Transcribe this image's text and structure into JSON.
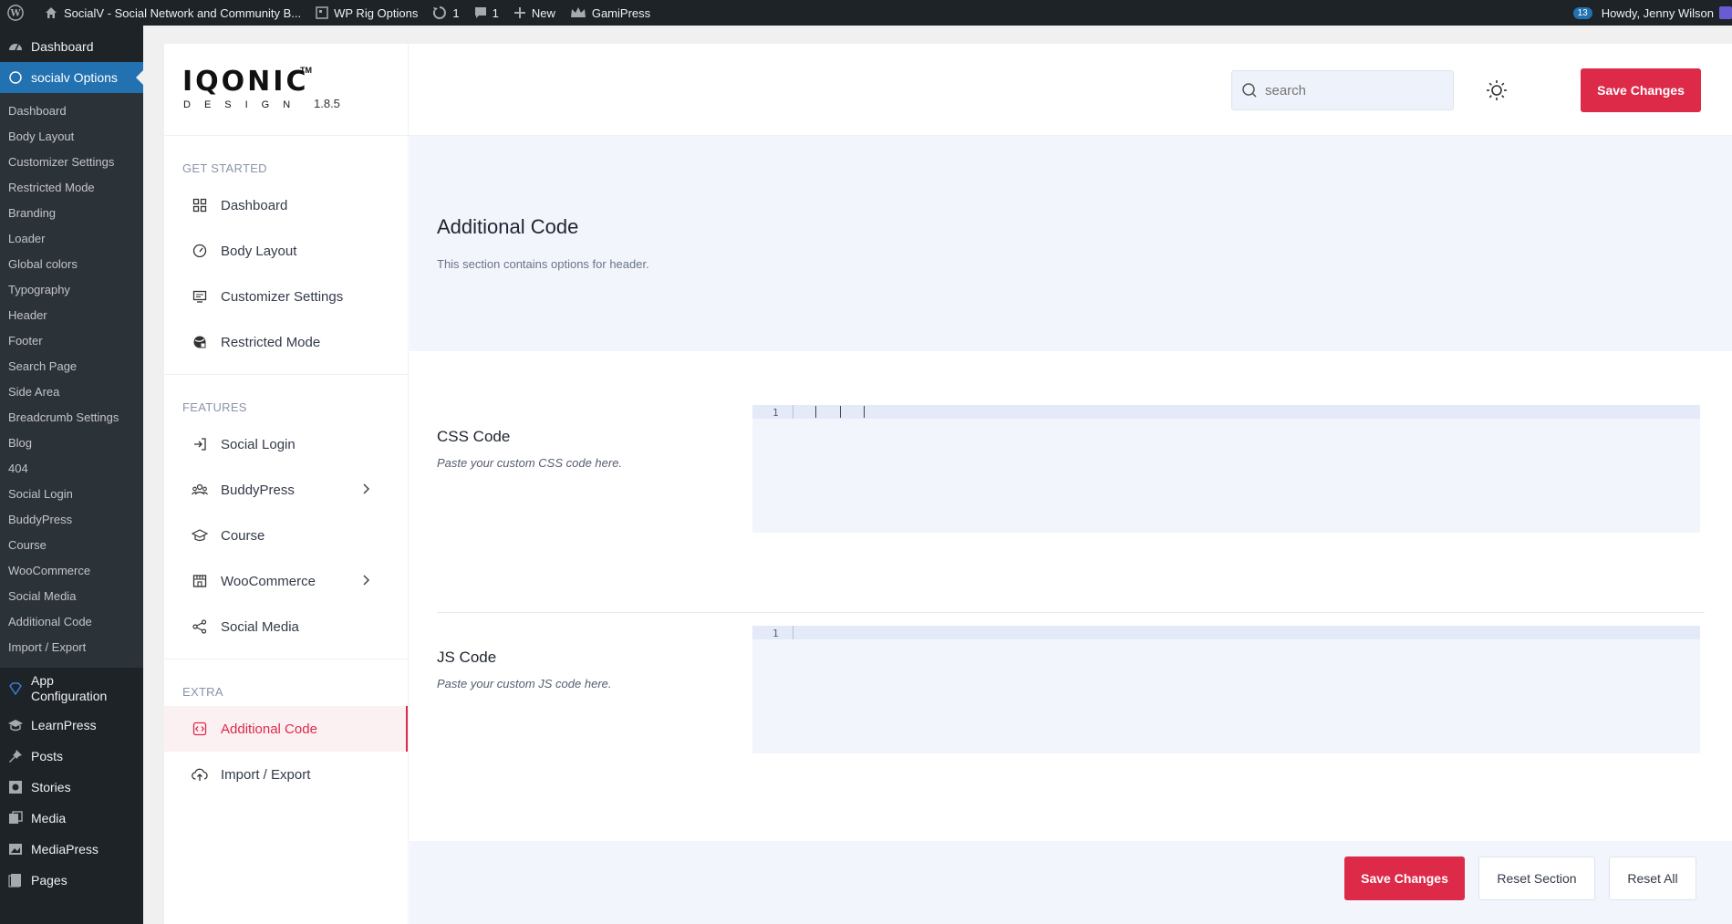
{
  "admin_bar": {
    "site_name": "SocialV - Social Network and Community B...",
    "wp_rig": "WP Rig Options",
    "updates_count": "1",
    "comments_count": "1",
    "new_label": "New",
    "gamipress": "GamiPress",
    "notifications_badge": "13",
    "howdy": "Howdy, Jenny Wilson"
  },
  "wp_menu": {
    "dashboard": "Dashboard",
    "current": "socialv Options",
    "submenu": [
      "Dashboard",
      "Body Layout",
      "Customizer Settings",
      "Restricted Mode",
      "Branding",
      "Loader",
      "Global colors",
      "Typography",
      "Header",
      "Footer",
      "Search Page",
      "Side Area",
      "Breadcrumb Settings",
      "Blog",
      "404",
      "Social Login",
      "BuddyPress",
      "Course",
      "WooCommerce",
      "Social Media",
      "Additional Code",
      "Import / Export"
    ],
    "app_config_line1": "App",
    "app_config_line2": "Configuration",
    "learnpress": "LearnPress",
    "posts": "Posts",
    "stories": "Stories",
    "media": "Media",
    "mediapress": "MediaPress",
    "pages": "Pages"
  },
  "logo": {
    "word": "IQONIC",
    "tm": "TM",
    "sub": "DESIGN",
    "version": "1.8.5"
  },
  "header": {
    "search_placeholder": "search",
    "save_label": "Save Changes"
  },
  "nav": {
    "get_started_heading": "GET STARTED",
    "get_started": [
      "Dashboard",
      "Body Layout",
      "Customizer Settings",
      "Restricted Mode"
    ],
    "features_heading": "FEATURES",
    "features": [
      "Social Login",
      "BuddyPress",
      "Course",
      "WooCommerce",
      "Social Media"
    ],
    "extra_heading": "EXTRA",
    "extra": [
      "Additional Code",
      "Import / Export"
    ]
  },
  "section": {
    "title": "Additional Code",
    "description": "This section contains options for header."
  },
  "fields": {
    "css_title": "CSS Code",
    "css_desc": "Paste your custom CSS code here.",
    "css_line_number": "1",
    "js_title": "JS Code",
    "js_desc": "Paste your custom JS code here.",
    "js_line_number": "1"
  },
  "footer": {
    "save_label": "Save Changes",
    "reset_section": "Reset Section",
    "reset_all": "Reset All"
  },
  "colors": {
    "accent": "#dd2a49",
    "wp_dark": "#1d2327",
    "wp_blue": "#2271b1",
    "panel_bg": "#f2f5fc"
  }
}
